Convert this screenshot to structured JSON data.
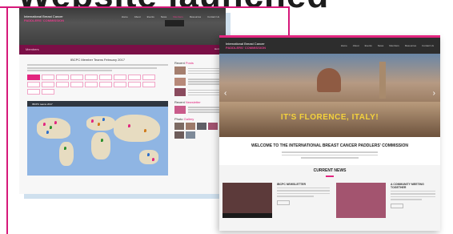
{
  "headline": "Website launched",
  "back_page": {
    "brand_line1": "International Breast Cancer",
    "brand_line2": "PADDLERS' COMMISSION",
    "nav": [
      "Home",
      "About",
      "Events",
      "News",
      "Members",
      "Resources",
      "Contact Us"
    ],
    "page_title": "Members",
    "page_title_right": "Home",
    "main_heading": "IBCPC Member Teams February 2017",
    "map_title": "IBCPC teams 2017",
    "sidebar_recent_posts": "Recent",
    "sidebar_recent_posts_accent": "Posts",
    "sidebar_recent_newsletter": "Recent",
    "sidebar_recent_newsletter_accent": "Newsletter",
    "sidebar_photos": "Photo",
    "sidebar_photos_accent": "Gallery"
  },
  "front_page": {
    "brand_line1": "International Breast Cancer",
    "brand_line2": "PADDLERS' COMMISSION",
    "nav": [
      "Home",
      "About",
      "Events",
      "News",
      "Members",
      "Resources",
      "Contact Us"
    ],
    "hero_caption": "IT'S FLORENCE, ITALY!",
    "welcome": "WELCOME TO THE INTERNATIONAL BREAST CANCER PADDLERS' COMMISSION",
    "news_title": "CURRENT NEWS",
    "news1_title": "IBCPC NEWSLETTER",
    "news2_title": "A COMMUNITY MEETING TOGETHER"
  },
  "colors": {
    "accent": "#e2257f",
    "frame": "#d6197a",
    "dark": "#2d2d2d"
  }
}
